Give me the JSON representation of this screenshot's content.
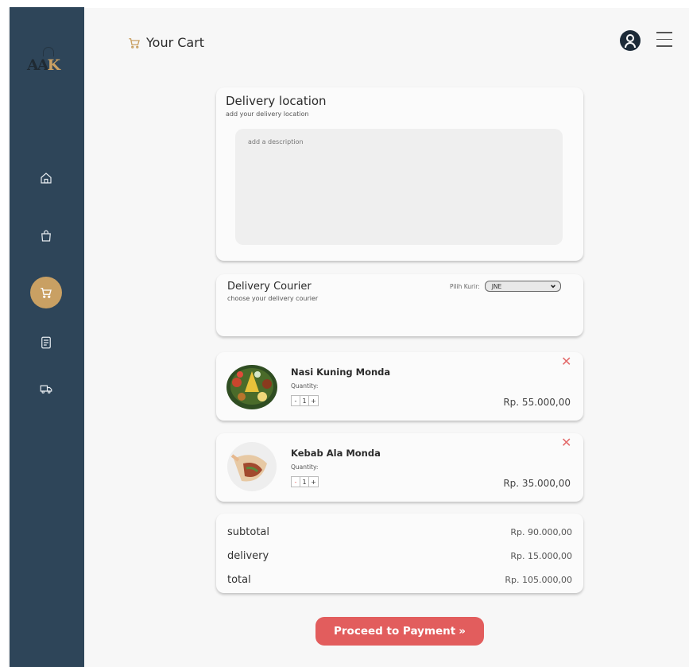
{
  "logo": {
    "part_a": "AA",
    "part_b": "K"
  },
  "nav": {
    "items": [
      {
        "icon": "home-icon"
      },
      {
        "icon": "shopping-bag-icon"
      },
      {
        "icon": "cart-icon",
        "active": true
      },
      {
        "icon": "receipt-icon"
      },
      {
        "icon": "truck-icon"
      }
    ]
  },
  "header": {
    "title": "Your Cart"
  },
  "delivery_location": {
    "title": "Delivery location",
    "subtitle": "add your delivery location",
    "placeholder": "add a description"
  },
  "courier": {
    "title": "Delivery Courier",
    "subtitle": "choose your delivery courier",
    "select_label": "Pilih Kurir:",
    "selected": "JNE"
  },
  "items": [
    {
      "name": "Nasi Kuning Monda",
      "qty_label": "Quantity:",
      "qty": "1",
      "minus": "-",
      "plus": "+",
      "price": "Rp. 55.000,00"
    },
    {
      "name": "Kebab Ala Monda",
      "qty_label": "Quantity:",
      "qty": "1",
      "minus": "-",
      "plus": "+",
      "price": "Rp. 35.000,00"
    }
  ],
  "summary": {
    "subtotal_label": "subtotal",
    "subtotal_value": "Rp. 90.000,00",
    "delivery_label": "delivery",
    "delivery_value": "Rp. 15.000,00",
    "total_label": "total",
    "total_value": "Rp. 105.000,00"
  },
  "payment_button": {
    "label": "Proceed to Payment",
    "arrow": "»"
  },
  "colors": {
    "sidebar": "#2e4559",
    "accent": "#c9a063",
    "button": "#e25d5d",
    "close": "#e36a6a"
  }
}
